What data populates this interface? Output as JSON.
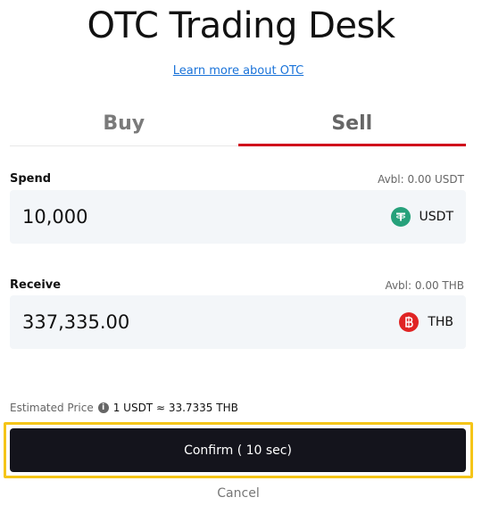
{
  "header": {
    "title": "OTC Trading Desk",
    "learn_more": "Learn more about OTC"
  },
  "tabs": [
    {
      "label": "Buy",
      "active": false
    },
    {
      "label": "Sell",
      "active": true
    }
  ],
  "spend": {
    "label": "Spend",
    "available": "Avbl: 0.00 USDT",
    "value": "10,000",
    "currency": "USDT",
    "currency_icon": "tether-icon",
    "currency_color": "#26a17b"
  },
  "receive": {
    "label": "Receive",
    "available": "Avbl: 0.00 THB",
    "value": "337,335.00",
    "currency": "THB",
    "currency_icon": "baht-icon",
    "currency_color": "#e02424"
  },
  "estimate": {
    "label": "Estimated Price",
    "value": "1 USDT ≈ 33.7335 THB"
  },
  "actions": {
    "confirm": "Confirm ( 10 sec)",
    "cancel": "Cancel"
  },
  "colors": {
    "accent_tab": "#d0021b",
    "focus_outline": "#f5c518",
    "button_bg": "#14141c",
    "link": "#1a73d9"
  }
}
